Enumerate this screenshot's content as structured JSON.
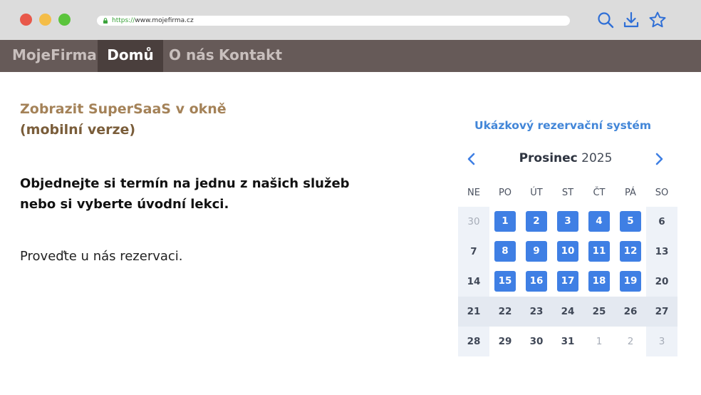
{
  "browser": {
    "url_protocol": "https://",
    "url_host": "www.mojefirma.cz",
    "icons": [
      "search-icon",
      "download-icon",
      "star-icon",
      "lock-icon"
    ]
  },
  "nav": {
    "brand": "MojeFirma",
    "items": [
      {
        "label": "Domů",
        "active": true
      },
      {
        "label": "O nás",
        "active": false
      },
      {
        "label": "Kontakt",
        "active": false
      }
    ]
  },
  "content": {
    "heading_line1": "Zobrazit SuperSaaS v okně",
    "heading_line2": "(mobilní verze)",
    "lead_line1": "Objednejte si termín na jednu z našich služeb",
    "lead_line2": "nebo si vyberte úvodní lekci.",
    "paragraph": "Proveďte u nás rezervaci."
  },
  "widget": {
    "title": "Ukázkový rezervační systém",
    "month": "Prosinec",
    "year": "2025",
    "days_of_week": [
      "NE",
      "PO",
      "ÚT",
      "ST",
      "ČT",
      "PÁ",
      "SO"
    ],
    "weeks": [
      [
        {
          "d": "30",
          "state": "muted"
        },
        {
          "d": "1",
          "state": "avail"
        },
        {
          "d": "2",
          "state": "avail"
        },
        {
          "d": "3",
          "state": "avail"
        },
        {
          "d": "4",
          "state": "avail"
        },
        {
          "d": "5",
          "state": "avail"
        },
        {
          "d": "6",
          "state": "normal"
        }
      ],
      [
        {
          "d": "7",
          "state": "normal"
        },
        {
          "d": "8",
          "state": "avail"
        },
        {
          "d": "9",
          "state": "avail"
        },
        {
          "d": "10",
          "state": "avail"
        },
        {
          "d": "11",
          "state": "avail"
        },
        {
          "d": "12",
          "state": "avail"
        },
        {
          "d": "13",
          "state": "normal"
        }
      ],
      [
        {
          "d": "14",
          "state": "normal"
        },
        {
          "d": "15",
          "state": "avail"
        },
        {
          "d": "16",
          "state": "avail"
        },
        {
          "d": "17",
          "state": "avail"
        },
        {
          "d": "18",
          "state": "avail"
        },
        {
          "d": "19",
          "state": "avail"
        },
        {
          "d": "20",
          "state": "normal"
        }
      ],
      [
        {
          "d": "21",
          "state": "normal"
        },
        {
          "d": "22",
          "state": "normal"
        },
        {
          "d": "23",
          "state": "normal"
        },
        {
          "d": "24",
          "state": "normal"
        },
        {
          "d": "25",
          "state": "normal"
        },
        {
          "d": "26",
          "state": "normal"
        },
        {
          "d": "27",
          "state": "normal"
        }
      ],
      [
        {
          "d": "28",
          "state": "normal"
        },
        {
          "d": "29",
          "state": "normal"
        },
        {
          "d": "30",
          "state": "normal"
        },
        {
          "d": "31",
          "state": "normal"
        },
        {
          "d": "1",
          "state": "muted"
        },
        {
          "d": "2",
          "state": "muted"
        },
        {
          "d": "3",
          "state": "muted"
        }
      ]
    ],
    "highlighted_week": 3,
    "colors": {
      "available": "#3f7fe4",
      "title": "#4286d8",
      "weekend_bg": "#eef2f8",
      "highlight_row": "#e4e9f1"
    }
  },
  "colors": {
    "nav_bg": "#665a58",
    "nav_active_bg": "#4a3f3d",
    "heading": "#a48258",
    "chrome_icons": "#2f6fd6"
  }
}
